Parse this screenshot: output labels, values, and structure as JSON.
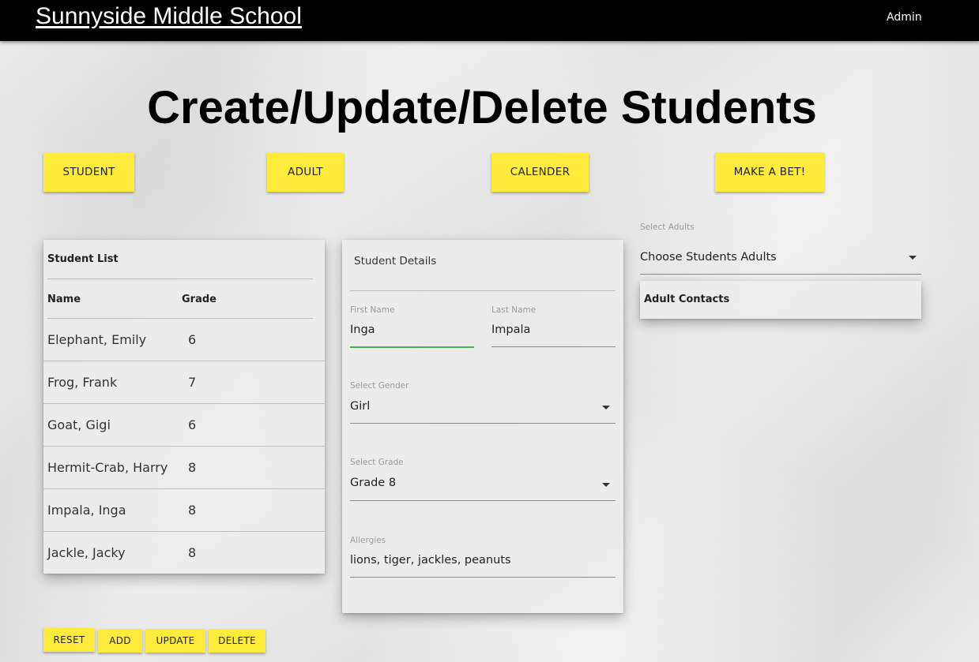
{
  "header": {
    "brand": "Sunnyside Middle School",
    "user": "Admin"
  },
  "page_title": "Create/Update/Delete Students",
  "nav_buttons": [
    "STUDENT",
    "ADULT",
    "CALENDER",
    "MAKE A BET!"
  ],
  "student_list": {
    "title": "Student List",
    "columns": [
      "Name",
      "Grade"
    ],
    "rows": [
      {
        "name": "Elephant, Emily",
        "grade": "6"
      },
      {
        "name": "Frog, Frank",
        "grade": "7"
      },
      {
        "name": "Goat, Gigi",
        "grade": "6"
      },
      {
        "name": "Hermit-Crab, Harry",
        "grade": "8"
      },
      {
        "name": "Impala, Inga",
        "grade": "8"
      },
      {
        "name": "Jackle, Jacky",
        "grade": "8"
      }
    ]
  },
  "student_details": {
    "title": "Student Details",
    "first_name": {
      "label": "First Name",
      "value": "Inga"
    },
    "last_name": {
      "label": "Last Name",
      "value": "Impala"
    },
    "gender": {
      "label": "Select Gender",
      "value": "Girl"
    },
    "grade": {
      "label": "Select Grade",
      "value": "Grade 8"
    },
    "allergies": {
      "label": "Allergies",
      "value": "lions, tiger, jackles, peanuts"
    }
  },
  "adults": {
    "label": "Select Adults",
    "value": "Choose Students Adults",
    "contacts_title": "Adult Contacts"
  },
  "action_buttons": [
    "RESET",
    "ADD",
    "UPDATE",
    "DELETE"
  ],
  "colors": {
    "button_yellow": "#ffeb3b",
    "header_bg": "#000000",
    "focus_green": "#4caf50"
  }
}
